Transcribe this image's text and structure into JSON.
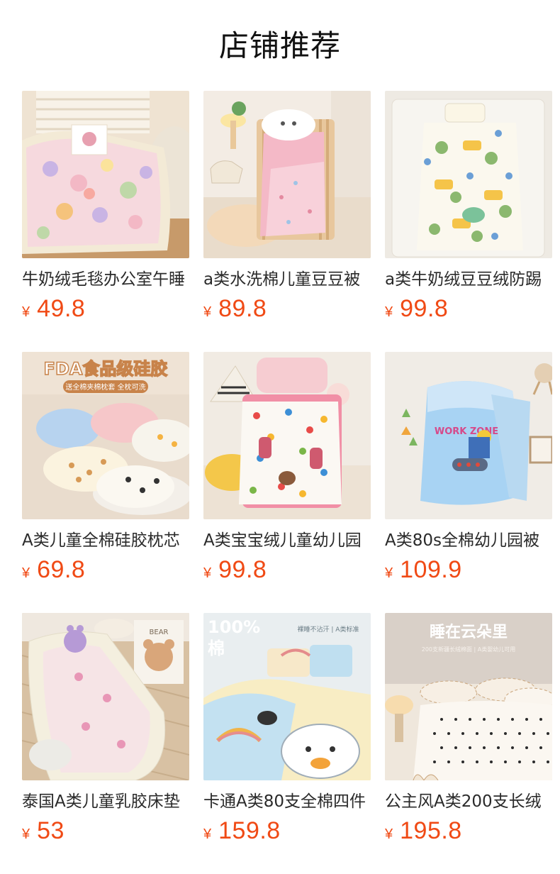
{
  "page": {
    "title": "店铺推荐"
  },
  "currency_symbol": "¥",
  "products": [
    {
      "name": "牛奶绒毛毯办公室午睡",
      "price": "49.8"
    },
    {
      "name": "a类水洗棉儿童豆豆被",
      "price": "89.8"
    },
    {
      "name": "a类牛奶绒豆豆绒防踢",
      "price": "99.8"
    },
    {
      "name": "A类儿童全棉硅胶枕芯",
      "price": "69.8",
      "image_text": {
        "headline": "FDA食品级硅胶",
        "tag": "送全棉夹棉枕套 全枕可洗"
      }
    },
    {
      "name": "A类宝宝绒儿童幼儿园",
      "price": "99.8"
    },
    {
      "name": "A类80s全棉幼儿园被",
      "price": "109.9",
      "image_text": {
        "tag": "WORK ZONE"
      }
    },
    {
      "name": "泰国A类儿童乳胶床垫",
      "price": "53",
      "image_text": {
        "tag": "BEAR"
      }
    },
    {
      "name": "卡通A类80支全棉四件",
      "price": "159.8",
      "image_text": {
        "headline": "100%",
        "sub": "棉",
        "tag": "裸睡不沾汗 | A类标准"
      }
    },
    {
      "name": "公主风A类200支长绒",
      "price": "195.8",
      "image_text": {
        "headline": "睡在云朵里",
        "tag": "200支新疆长绒棉面 | A类婴幼儿可用"
      }
    }
  ]
}
